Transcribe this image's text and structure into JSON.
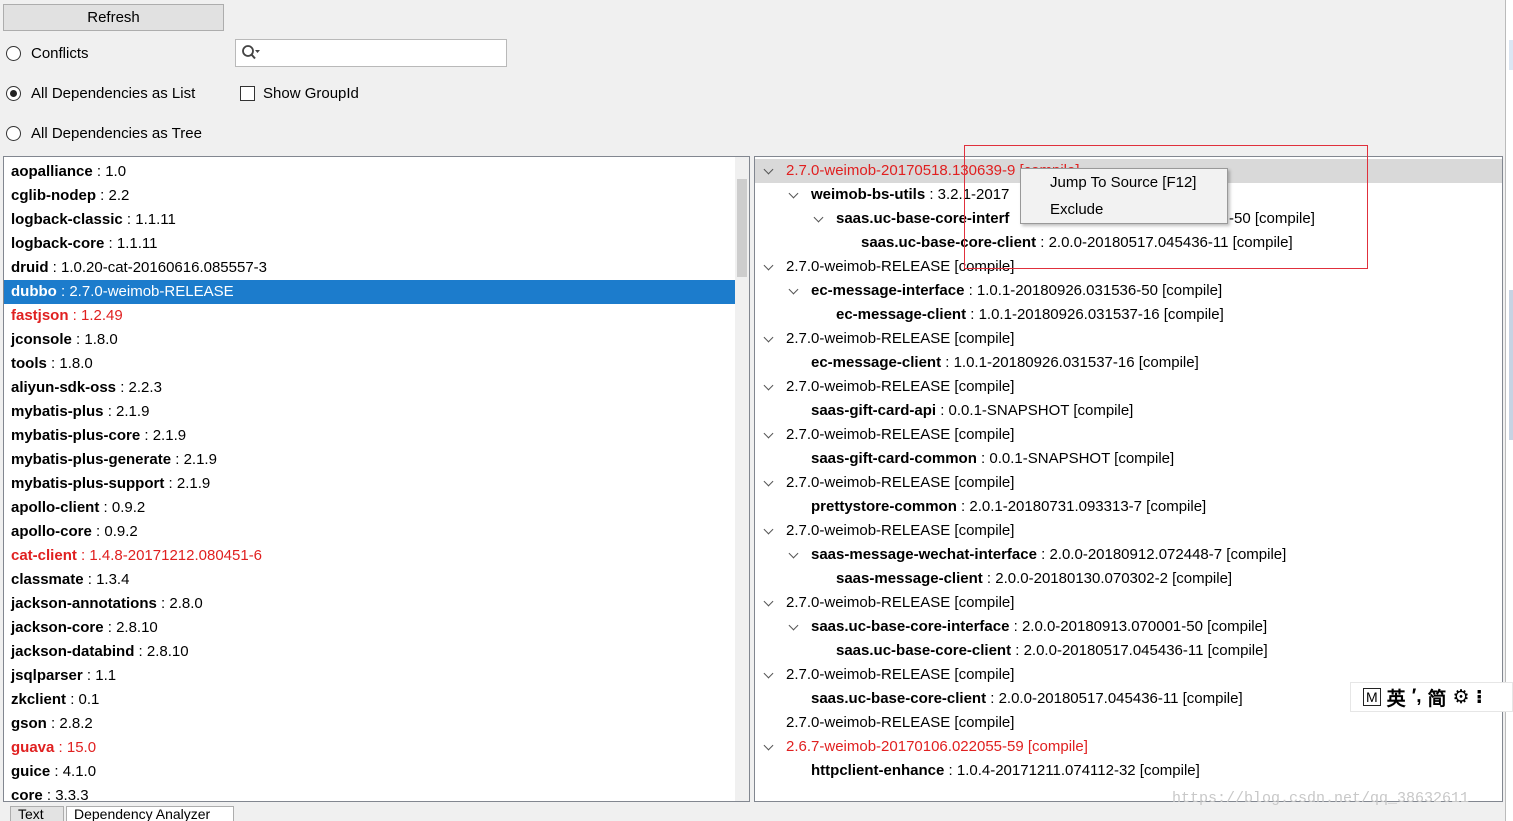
{
  "toolbar": {
    "refresh_label": "Refresh"
  },
  "modes": {
    "conflicts": "Conflicts",
    "list": "All Dependencies as List",
    "tree": "All Dependencies as Tree",
    "selected": "list"
  },
  "search": {
    "placeholder": "",
    "value": ""
  },
  "show_group_id": {
    "label": "Show GroupId",
    "checked": false
  },
  "left_list": [
    {
      "name": "aopalliance",
      "version": "1.0",
      "conflict": false
    },
    {
      "name": "cglib-nodep",
      "version": "2.2",
      "conflict": false
    },
    {
      "name": "logback-classic",
      "version": "1.1.11",
      "conflict": false
    },
    {
      "name": "logback-core",
      "version": "1.1.11",
      "conflict": false
    },
    {
      "name": "druid",
      "version": "1.0.20-cat-20160616.085557-3",
      "conflict": false
    },
    {
      "name": "dubbo",
      "version": "2.7.0-weimob-RELEASE",
      "conflict": false,
      "selected": true
    },
    {
      "name": "fastjson",
      "version": "1.2.49",
      "conflict": true
    },
    {
      "name": "jconsole",
      "version": "1.8.0",
      "conflict": false
    },
    {
      "name": "tools",
      "version": "1.8.0",
      "conflict": false
    },
    {
      "name": "aliyun-sdk-oss",
      "version": "2.2.3",
      "conflict": false
    },
    {
      "name": "mybatis-plus",
      "version": "2.1.9",
      "conflict": false
    },
    {
      "name": "mybatis-plus-core",
      "version": "2.1.9",
      "conflict": false
    },
    {
      "name": "mybatis-plus-generate",
      "version": "2.1.9",
      "conflict": false
    },
    {
      "name": "mybatis-plus-support",
      "version": "2.1.9",
      "conflict": false
    },
    {
      "name": "apollo-client",
      "version": "0.9.2",
      "conflict": false
    },
    {
      "name": "apollo-core",
      "version": "0.9.2",
      "conflict": false
    },
    {
      "name": "cat-client",
      "version": "1.4.8-20171212.080451-6",
      "conflict": true
    },
    {
      "name": "classmate",
      "version": "1.3.4",
      "conflict": false
    },
    {
      "name": "jackson-annotations",
      "version": "2.8.0",
      "conflict": false
    },
    {
      "name": "jackson-core",
      "version": "2.8.10",
      "conflict": false
    },
    {
      "name": "jackson-databind",
      "version": "2.8.10",
      "conflict": false
    },
    {
      "name": "jsqlparser",
      "version": "1.1",
      "conflict": false
    },
    {
      "name": "zkclient",
      "version": "0.1",
      "conflict": false
    },
    {
      "name": "gson",
      "version": "2.8.2",
      "conflict": false
    },
    {
      "name": "guava",
      "version": "15.0",
      "conflict": true
    },
    {
      "name": "guice",
      "version": "4.1.0",
      "conflict": false
    },
    {
      "name": "core",
      "version": "3.3.3",
      "conflict": false
    }
  ],
  "tree": [
    {
      "level": 0,
      "expand": true,
      "bold": "",
      "text": "2.7.0-weimob-20170518.130639-9 [compile]",
      "conflict": true,
      "highlight": true
    },
    {
      "level": 1,
      "expand": true,
      "bold": "weimob-bs-utils",
      "text": " : 3.2.1-2017",
      "conflict": false
    },
    {
      "level": 2,
      "expand": true,
      "bold": "saas.uc-base-core-interf",
      "text": "",
      "conflict": false,
      "tail": "-50 [compile]"
    },
    {
      "level": 3,
      "expand": false,
      "bold": "saas.uc-base-core-client",
      "text": " : 2.0.0-20180517.045436-11 [compile]",
      "conflict": false
    },
    {
      "level": 0,
      "expand": true,
      "bold": "",
      "text": "2.7.0-weimob-RELEASE [compile]",
      "conflict": false
    },
    {
      "level": 1,
      "expand": true,
      "bold": "ec-message-interface",
      "text": " : 1.0.1-20180926.031536-50 [compile]",
      "conflict": false
    },
    {
      "level": 2,
      "expand": false,
      "bold": "ec-message-client",
      "text": " : 1.0.1-20180926.031537-16 [compile]",
      "conflict": false
    },
    {
      "level": 0,
      "expand": true,
      "bold": "",
      "text": "2.7.0-weimob-RELEASE [compile]",
      "conflict": false
    },
    {
      "level": 1,
      "expand": false,
      "bold": "ec-message-client",
      "text": " : 1.0.1-20180926.031537-16 [compile]",
      "conflict": false
    },
    {
      "level": 0,
      "expand": true,
      "bold": "",
      "text": "2.7.0-weimob-RELEASE [compile]",
      "conflict": false
    },
    {
      "level": 1,
      "expand": false,
      "bold": "saas-gift-card-api",
      "text": " : 0.0.1-SNAPSHOT [compile]",
      "conflict": false
    },
    {
      "level": 0,
      "expand": true,
      "bold": "",
      "text": "2.7.0-weimob-RELEASE [compile]",
      "conflict": false
    },
    {
      "level": 1,
      "expand": false,
      "bold": "saas-gift-card-common",
      "text": " : 0.0.1-SNAPSHOT [compile]",
      "conflict": false
    },
    {
      "level": 0,
      "expand": true,
      "bold": "",
      "text": "2.7.0-weimob-RELEASE [compile]",
      "conflict": false
    },
    {
      "level": 1,
      "expand": false,
      "bold": "prettystore-common",
      "text": " : 2.0.1-20180731.093313-7 [compile]",
      "conflict": false
    },
    {
      "level": 0,
      "expand": true,
      "bold": "",
      "text": "2.7.0-weimob-RELEASE [compile]",
      "conflict": false
    },
    {
      "level": 1,
      "expand": true,
      "bold": "saas-message-wechat-interface",
      "text": " : 2.0.0-20180912.072448-7 [compile]",
      "conflict": false
    },
    {
      "level": 2,
      "expand": false,
      "bold": "saas-message-client",
      "text": " : 2.0.0-20180130.070302-2 [compile]",
      "conflict": false
    },
    {
      "level": 0,
      "expand": true,
      "bold": "",
      "text": "2.7.0-weimob-RELEASE [compile]",
      "conflict": false
    },
    {
      "level": 1,
      "expand": true,
      "bold": "saas.uc-base-core-interface",
      "text": " : 2.0.0-20180913.070001-50 [compile]",
      "conflict": false
    },
    {
      "level": 2,
      "expand": false,
      "bold": "saas.uc-base-core-client",
      "text": " : 2.0.0-20180517.045436-11 [compile]",
      "conflict": false
    },
    {
      "level": 0,
      "expand": true,
      "bold": "",
      "text": "2.7.0-weimob-RELEASE [compile]",
      "conflict": false
    },
    {
      "level": 1,
      "expand": false,
      "bold": "saas.uc-base-core-client",
      "text": " : 2.0.0-20180517.045436-11 [compile]",
      "conflict": false
    },
    {
      "level": 0,
      "expand": false,
      "bold": "",
      "text": "2.7.0-weimob-RELEASE [compile]",
      "conflict": false
    },
    {
      "level": 0,
      "expand": true,
      "bold": "",
      "text": "2.6.7-weimob-20170106.022055-59 [compile]",
      "conflict": true
    },
    {
      "level": 1,
      "expand": false,
      "bold": "httpclient-enhance",
      "text": " : 1.0.4-20171211.074112-32 [compile]",
      "conflict": false
    }
  ],
  "context_menu": {
    "jump_label": "Jump To Source [F12]",
    "exclude_label": "Exclude"
  },
  "ime": {
    "m": "M",
    "lang": "英",
    "punct": "′,",
    "mode": "简",
    "gear": "⚙",
    "more": "⁝"
  },
  "tabs": {
    "text": "Text",
    "analyzer": "Dependency Analyzer"
  },
  "watermark": "https://blog.csdn.net/qq_38632611",
  "colors": {
    "selection": "#1c7ccc",
    "conflict": "#e02020",
    "highlight_box": "#e0303c"
  }
}
